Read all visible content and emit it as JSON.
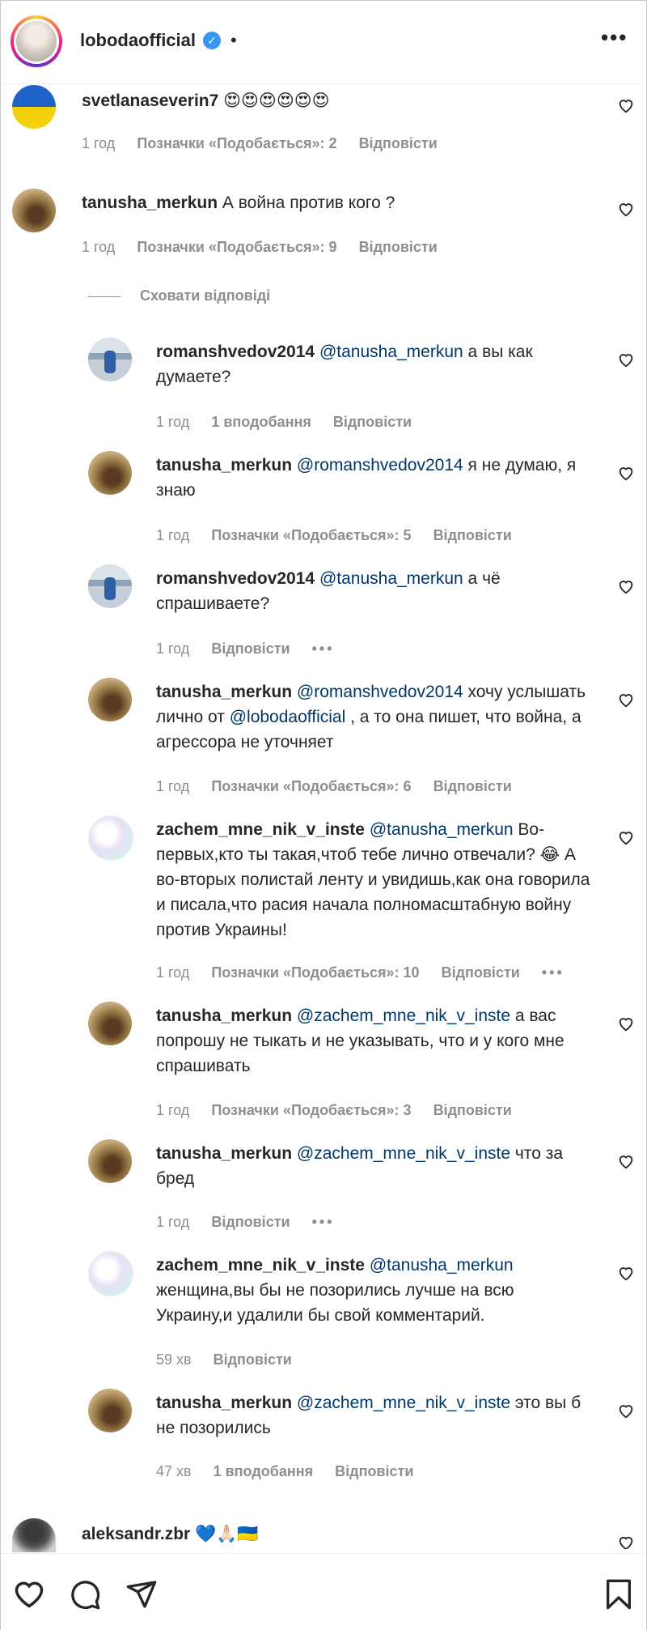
{
  "header": {
    "username": "lobodaofficial",
    "dot": "•",
    "more": "•••"
  },
  "hide_replies": "Сховати відповіді",
  "reply_label": "Відповісти",
  "comments": [
    {
      "username": "svetlanaseverin7",
      "text": "😍😍😍😍😍😍",
      "time": "1 год",
      "likes": "Позначки «Подобається»: 2"
    },
    {
      "username": "tanusha_merkun",
      "text": "А война против кого ?",
      "time": "1 год",
      "likes": "Позначки «Подобається»: 9"
    },
    {
      "username": "romanshvedov2014",
      "mention": "@tanusha_merkun",
      "text": " а вы как думаете?",
      "time": "1 год",
      "likes": "1 вподобання"
    },
    {
      "username": "tanusha_merkun",
      "mention": "@romanshvedov2014",
      "text": " я не думаю, я знаю",
      "time": "1 год",
      "likes": "Позначки «Подобається»: 5"
    },
    {
      "username": "romanshvedov2014",
      "mention": "@tanusha_merkun",
      "text": " а чё спрашиваете?",
      "time": "1 год",
      "more": "•••"
    },
    {
      "username": "tanusha_merkun",
      "mention": "@romanshvedov2014",
      "text": " хочу услышать лично от ",
      "mention2": "@lobodaofficial",
      "text2": " , а то она пишет, что война, а агрессора не уточняет",
      "time": "1 год",
      "likes": "Позначки «Подобається»: 6"
    },
    {
      "username": "zachem_mne_nik_v_inste",
      "mention": "@tanusha_merkun",
      "text": " Во-первых,кто ты такая,чтоб тебе лично отвечали? 😂 А во-вторых полистай ленту и увидишь,как она говорила и писала,что расия начала полномасштабную войну против Украины!",
      "time": "1 год",
      "likes": "Позначки «Подобається»: 10",
      "more": "•••"
    },
    {
      "username": "tanusha_merkun",
      "mention": "@zachem_mne_nik_v_inste",
      "text": " а вас попрошу не тыкать и не указывать, что и у кого мне спрашивать",
      "time": "1 год",
      "likes": "Позначки «Подобається»: 3"
    },
    {
      "username": "tanusha_merkun",
      "mention": "@zachem_mne_nik_v_inste",
      "text": " что за бред",
      "time": "1 год",
      "more": "•••"
    },
    {
      "username": "zachem_mne_nik_v_inste",
      "mention": "@tanusha_merkun",
      "text": " женщина,вы бы не позорились лучше на всю Украину,и удалили бы свой комментарий.",
      "time": "59 хв"
    },
    {
      "username": "tanusha_merkun",
      "mention": "@zachem_mne_nik_v_inste",
      "text": " это вы б не позорились",
      "time": "47 хв",
      "likes": "1 вподобання"
    },
    {
      "username": "aleksandr.zbr",
      "text": "💙🙏🏻🇺🇦"
    }
  ],
  "icon_names": [
    "heart-icon",
    "comment-icon",
    "share-icon",
    "bookmark-icon",
    "verified-icon",
    "more-icon"
  ],
  "colors": {
    "mention": "#00376b",
    "meta": "#8e8e8e",
    "verified": "#3897f0",
    "text": "#262626"
  }
}
